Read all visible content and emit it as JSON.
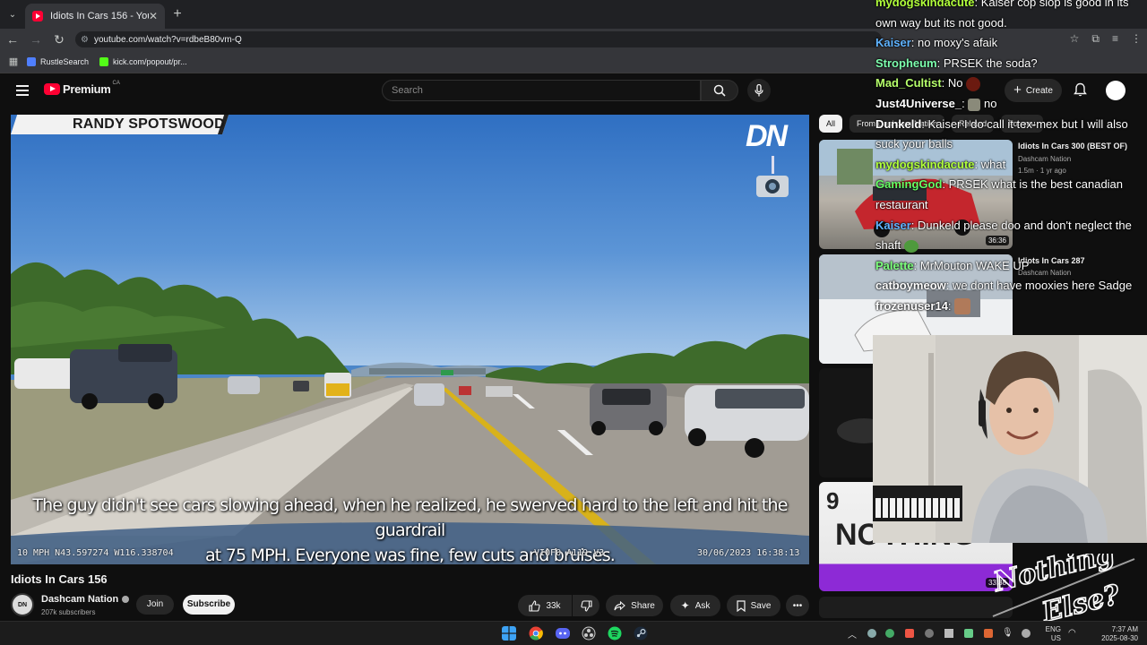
{
  "browser": {
    "tab_title": "Idiots In Cars 156 - YouTube",
    "url": "youtube.com/watch?v=rdbeB80vm-Q",
    "bookmarks": [
      {
        "label": "RustleSearch",
        "color": "#4f7fff"
      },
      {
        "label": "kick.com/popout/pr...",
        "color": "#53fc18"
      }
    ]
  },
  "youtube": {
    "logo_text": "Premium",
    "country": "CA",
    "search_placeholder": "Search",
    "create_label": "Create"
  },
  "video": {
    "name_plate": "RANDY SPOTSWOOD",
    "watermark": "DN",
    "subtitle_line1": "The guy didn't see cars slowing ahead, when he realized, he swerved hard to the left and hit the guardrail",
    "subtitle_line2": "at 75 MPH. Everyone was fine, few cuts and bruises.",
    "overlay_left": "10 MPH N43.597274 W116.338704",
    "overlay_mid": "VIOFO A119 V3",
    "overlay_right": "30/06/2023 16:38:13",
    "title": "Idiots In Cars 156",
    "channel": "Dashcam Nation",
    "subscribers": "207k subscribers",
    "join": "Join",
    "subscribe": "Subscribe",
    "likes": "33k",
    "share": "Share",
    "ask": "Ask",
    "save": "Save"
  },
  "sidebar": {
    "chips": [
      "All",
      "From Dashcam Nation",
      "Related",
      "For you"
    ],
    "recs": [
      {
        "title": "Idiots In Cars 300 (BEST OF)",
        "channel": "Dashcam Nation",
        "meta": "1.5m · 1 yr ago",
        "duration": "36:36"
      },
      {
        "title": "Idiots In Cars 287",
        "channel": "Dashcam Nation",
        "duration": ""
      },
      {
        "title": "",
        "channel": "",
        "duration": ""
      },
      {
        "title": "",
        "channel": "",
        "duration": "33:38"
      }
    ]
  },
  "chat": [
    {
      "user": "mydogskindacute",
      "color": "#b1ff3b",
      "msg": "Kaiser cop slop is good in its own way but its not good."
    },
    {
      "user": "Kaiser",
      "color": "#5fb3ff",
      "msg": "no moxy's afaik"
    },
    {
      "user": "Stropheum",
      "color": "#7dffae",
      "msg": "PRSEK the soda?"
    },
    {
      "user": "Mad_Cultist",
      "color": "#b6ff6b",
      "msg": "No"
    },
    {
      "user": "Just4Universe_",
      "color": "#ffffff",
      "msg": "no"
    },
    {
      "user": "Dunkeld",
      "color": "#ffffff",
      "msg": "Kaiser I do call it tex-mex but I will also suck your balls"
    },
    {
      "user": "mydogskindacute",
      "color": "#b1ff3b",
      "msg": "what"
    },
    {
      "user": "GamingGod",
      "color": "#66ff66",
      "msg": "PRSEK what is the best canadian restaurant"
    },
    {
      "user": "Kaiser",
      "color": "#5fb3ff",
      "msg": "Dunkeld please doo and don't neglect the shaft"
    },
    {
      "user": "Palette",
      "color": "#7dff7d",
      "msg": "MrMouton WAKE UP"
    },
    {
      "user": "catboymeow",
      "color": "#ffffff",
      "msg": "we dont have mooxies here Sadge"
    },
    {
      "user": "frozenuser14",
      "color": "#ffffff",
      "msg": ""
    }
  ],
  "brand_art": "Nothing Else?",
  "taskbar": {
    "lang": "ENG",
    "region": "US",
    "time": "7:37 AM",
    "date": "2025-08-30"
  }
}
